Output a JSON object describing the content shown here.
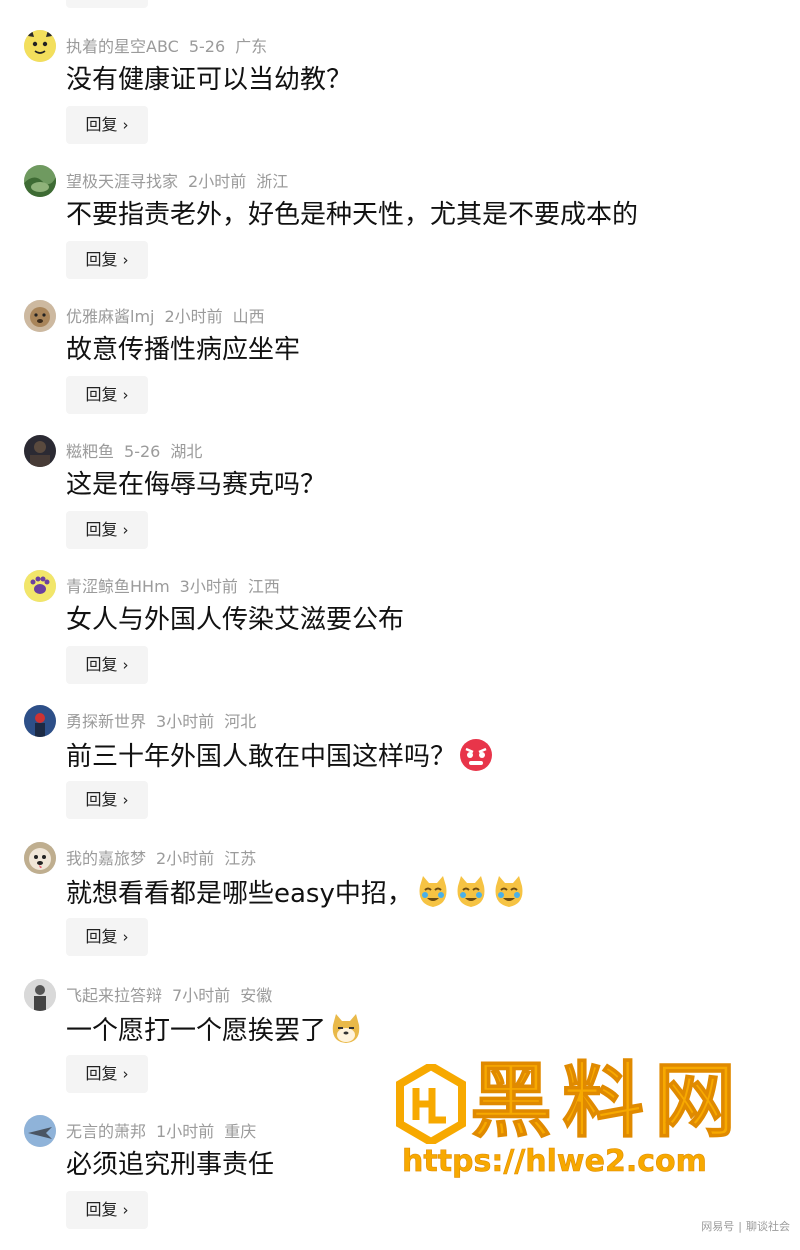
{
  "reply_label": "回复",
  "comments": [
    {
      "username": "执着的星空ABC",
      "time": "5-26",
      "location": "广东",
      "text": "没有健康证可以当幼教？",
      "avatar": "yellow-cartoon-avatar"
    },
    {
      "username": "望极天涯寻找家",
      "time": "2小时前",
      "location": "浙江",
      "text": "不要指责老外，好色是种天性，尤其是不要成本的",
      "avatar": "landscape-avatar"
    },
    {
      "username": "优雅麻酱lmj",
      "time": "2小时前",
      "location": "山西",
      "text": "故意传播性病应坐牢",
      "avatar": "dog-avatar"
    },
    {
      "username": "糍粑鱼",
      "time": "5-26",
      "location": "湖北",
      "text": "这是在侮辱马赛克吗？",
      "avatar": "dark-scene-avatar"
    },
    {
      "username": "青涩鲸鱼HHm",
      "time": "3小时前",
      "location": "江西",
      "text": "女人与外国人传染艾滋要公布",
      "avatar": "paw-avatar"
    },
    {
      "username": "勇探新世界",
      "time": "3小时前",
      "location": "河北",
      "text": "前三十年外国人敢在中国这样吗？",
      "avatar": "explorer-avatar",
      "emojis": [
        "angry-face-emoji"
      ]
    },
    {
      "username": "我的嘉旅梦",
      "time": "2小时前",
      "location": "江苏",
      "text": "就想看看都是哪些easy中招，",
      "avatar": "dog-face-avatar",
      "emojis": [
        "cat-laugh-emoji",
        "cat-laugh-emoji",
        "cat-laugh-emoji"
      ]
    },
    {
      "username": "飞起来拉答辩",
      "time": "7小时前",
      "location": "安徽",
      "text": "一个愿打一个愿挨罢了",
      "avatar": "person-avatar",
      "emojis": [
        "doge-emoji"
      ]
    },
    {
      "username": "无言的萧邦",
      "time": "1小时前",
      "location": "重庆",
      "text": "必须追究刑事责任",
      "avatar": "jet-avatar"
    }
  ],
  "watermark": {
    "title": "黑料网",
    "url": "https://hlwe2.com",
    "color": "#f7a900"
  },
  "source_brand": "网易号",
  "source_channel": "聊谈社会",
  "colors": {
    "text": "#111111",
    "meta": "#9b9b9b",
    "reply_bg": "#f4f4f4"
  }
}
